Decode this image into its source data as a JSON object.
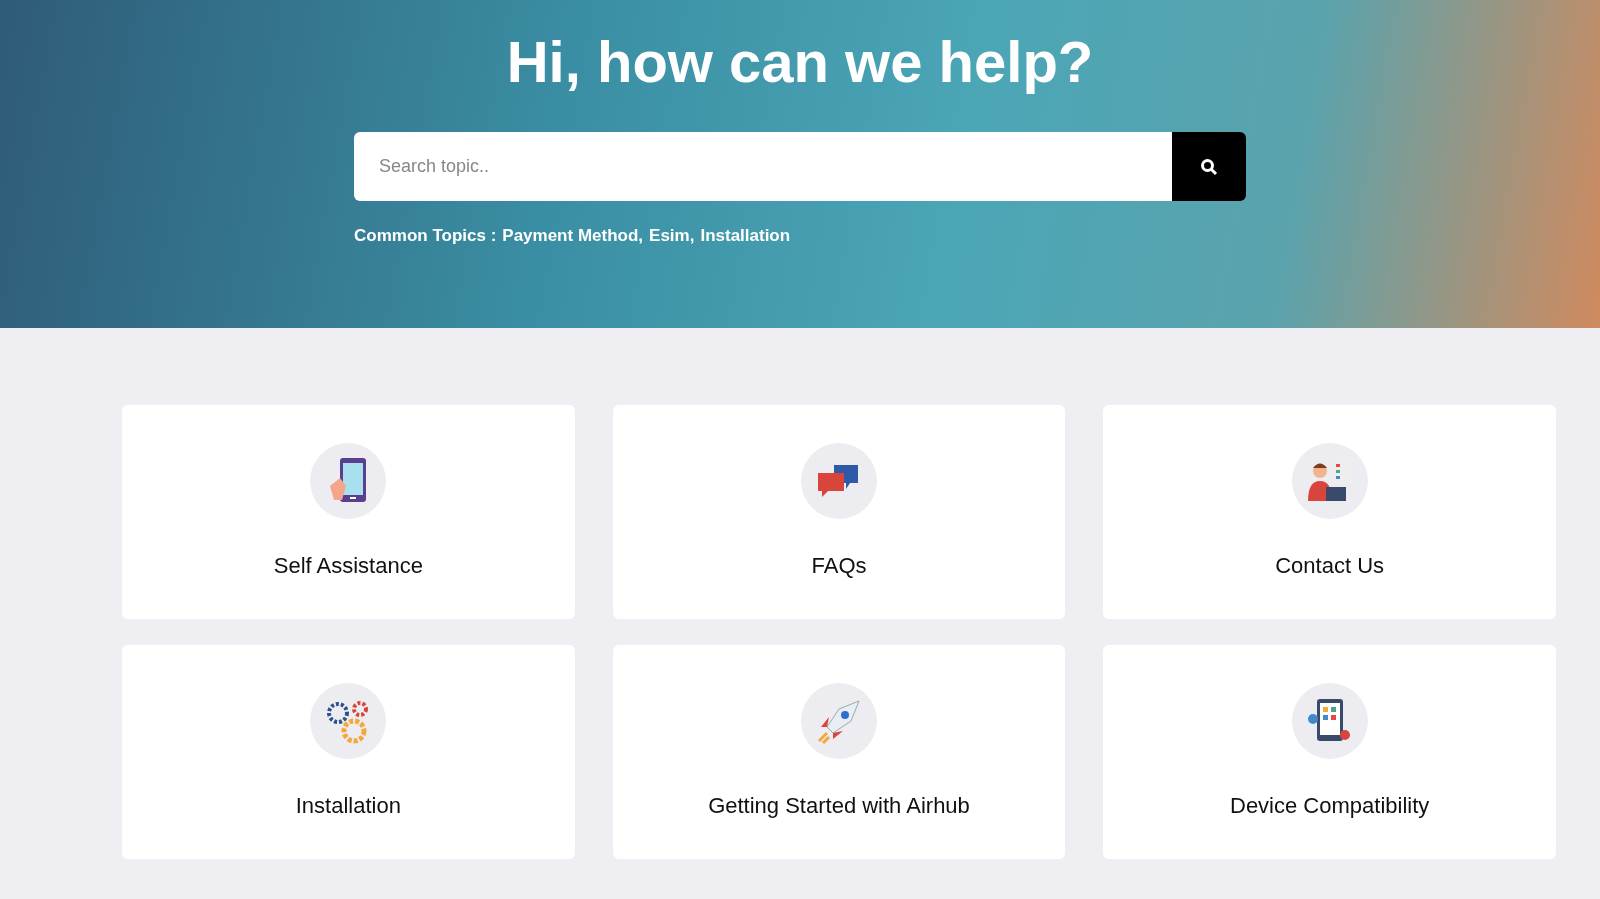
{
  "hero": {
    "title": "Hi, how can we help?",
    "search": {
      "placeholder": "Search topic.."
    },
    "common_topics": {
      "label": "Common Topics :",
      "topics": [
        "Payment Method,",
        "Esim,",
        "Installation"
      ]
    }
  },
  "cards": [
    {
      "kind": "phone",
      "label": "Self Assistance"
    },
    {
      "kind": "chat",
      "label": "FAQs"
    },
    {
      "kind": "person",
      "label": "Contact Us"
    },
    {
      "kind": "gears",
      "label": "Installation"
    },
    {
      "kind": "rocket",
      "label": "Getting Started with Airhub"
    },
    {
      "kind": "device",
      "label": "Device Compatibility"
    }
  ]
}
